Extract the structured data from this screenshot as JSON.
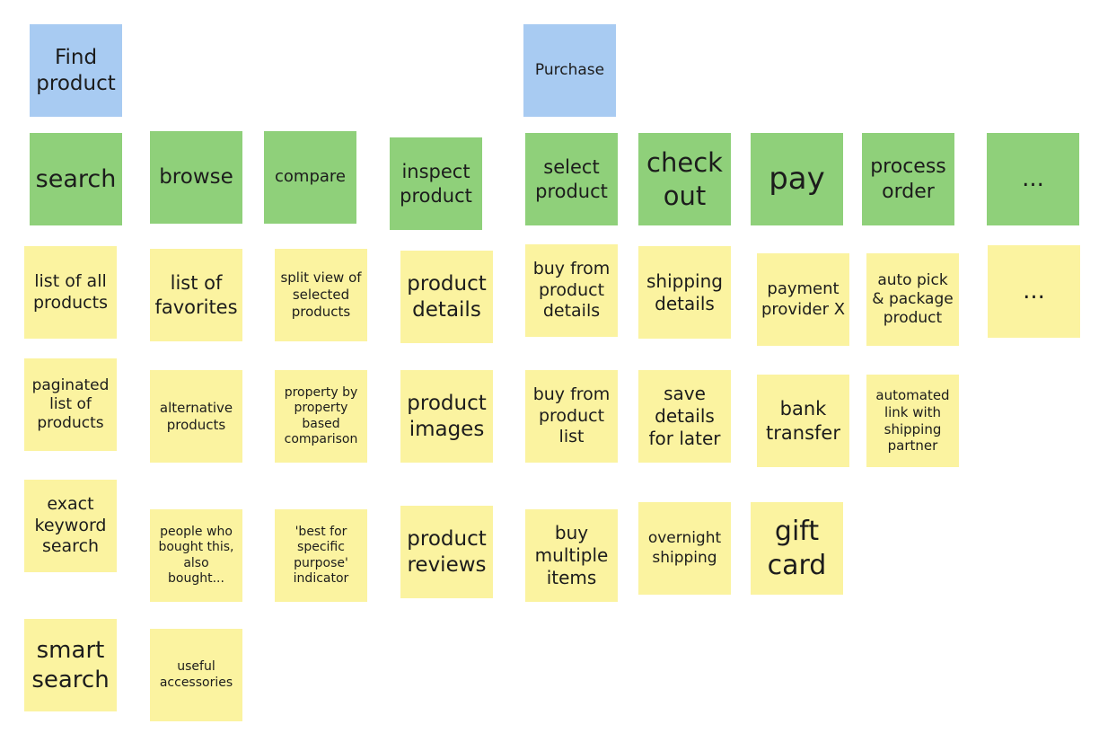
{
  "colors": {
    "activity": "#a8cbf2",
    "task": "#8fd07a",
    "story": "#fbf3a0"
  },
  "activities": {
    "find_product": "Find product",
    "purchase": "Purchase"
  },
  "tasks": {
    "search": "search",
    "browse": "browse",
    "compare": "compare",
    "inspect_product": "inspect product",
    "select_product": "select product",
    "check_out": "check out",
    "pay": "pay",
    "process_order": "process order",
    "more": "..."
  },
  "stories": {
    "search": [
      "list of all products",
      "paginated list of products",
      "exact keyword search",
      "smart search"
    ],
    "browse": [
      "list of favorites",
      "alternative products",
      "people who bought this, also bought...",
      "useful accessories"
    ],
    "compare": [
      "split view of selected products",
      "property by property based comparison",
      "'best for specific purpose' indicator"
    ],
    "inspect_product": [
      "product details",
      "product images",
      "product reviews"
    ],
    "select_product": [
      "buy from product details",
      "buy from product list",
      "buy multiple items"
    ],
    "check_out": [
      "shipping details",
      "save details for later",
      "overnight shipping"
    ],
    "pay": [
      "payment provider X",
      "bank transfer",
      "gift card"
    ],
    "process_order": [
      "auto pick & package product",
      "automated link with shipping partner"
    ],
    "more": [
      "..."
    ]
  }
}
